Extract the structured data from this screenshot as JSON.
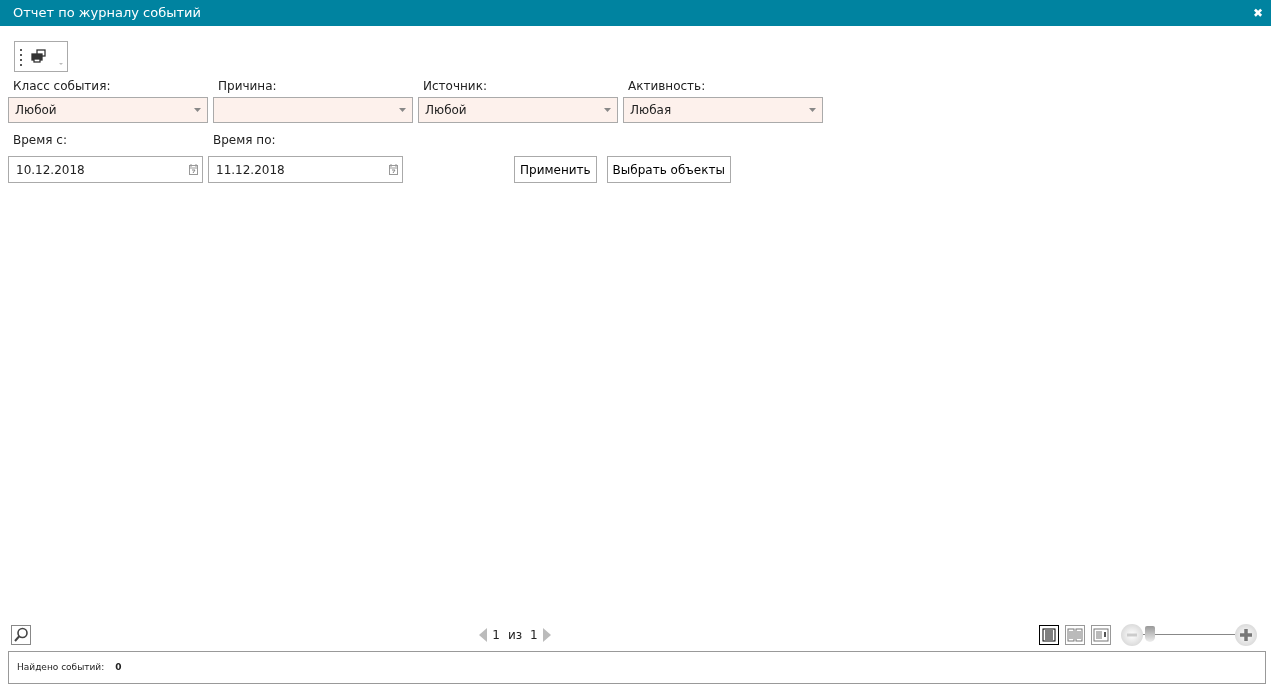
{
  "window": {
    "title": "Отчет по журналу событий",
    "close": "✖"
  },
  "filters": [
    {
      "label": "Класс события:",
      "value": "Любой"
    },
    {
      "label": "Причина:"
    },
    {
      "label": "Источник:",
      "value": "Любой"
    },
    {
      "label": "Активность:",
      "value": "Любая"
    }
  ],
  "dates": [
    {
      "label": "Время с:",
      "value": "10.12.2018"
    },
    {
      "label": "Время по:",
      "value": "11.12.2018"
    }
  ],
  "buttons": [
    "Применить",
    "Выбрать объекты"
  ],
  "pager": {
    "current": "1",
    "separator": "из",
    "total": "1"
  },
  "view_modes": [
    {
      "kind": "single",
      "selected": true
    },
    {
      "kind": "double",
      "selected": false
    },
    {
      "kind": "side",
      "selected": false
    }
  ],
  "zoom": {
    "level": 0.03
  },
  "status": {
    "label": "Найдено событий:",
    "value": "0"
  }
}
